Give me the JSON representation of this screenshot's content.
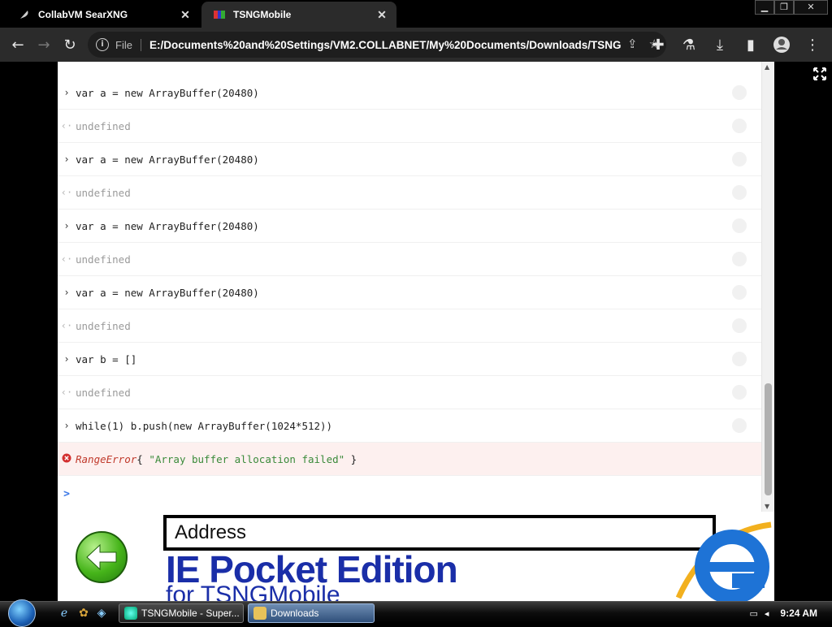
{
  "browser": {
    "tabs": [
      {
        "title": "CollabVM SearXNG",
        "active": false
      },
      {
        "title": "TSNGMobile",
        "active": true
      }
    ],
    "window_controls": [
      "minimize",
      "restore",
      "close"
    ],
    "omnibox": {
      "scheme": "File",
      "url": "E:/Documents%20and%20Settings/VM2.COLLABNET/My%20Documents/Downloads/TSNG..."
    }
  },
  "console": {
    "rows": [
      {
        "kind": "input",
        "text": "var a = new ArrayBuffer(20480)"
      },
      {
        "kind": "output",
        "text": "undefined"
      },
      {
        "kind": "input",
        "text": "var a = new ArrayBuffer(20480)"
      },
      {
        "kind": "output",
        "text": "undefined"
      },
      {
        "kind": "input",
        "text": "var a = new ArrayBuffer(20480)"
      },
      {
        "kind": "output",
        "text": "undefined"
      },
      {
        "kind": "input",
        "text": "var a = new ArrayBuffer(20480)"
      },
      {
        "kind": "output",
        "text": "undefined"
      },
      {
        "kind": "input",
        "text": "var b = []"
      },
      {
        "kind": "output",
        "text": "undefined"
      },
      {
        "kind": "input",
        "text": "while(1) b.push(new ArrayBuffer(1024*512))"
      }
    ],
    "error": {
      "name": "RangeError",
      "open": "{ ",
      "message": "\"Array buffer allocation failed\"",
      "close": " }"
    },
    "prompt_symbol": ">"
  },
  "banner": {
    "address_label": "Address",
    "title": "IE Pocket Edition",
    "subtitle": "for TSNGMobile"
  },
  "taskbar": {
    "tasks": [
      {
        "label": "TSNGMobile - Super...",
        "active": false
      },
      {
        "label": "Downloads",
        "active": true
      }
    ],
    "clock": "9:24 AM"
  },
  "colors": {
    "error_red": "#c0392b",
    "string_green": "#3a8a3a",
    "prompt_blue": "#3b78e7",
    "ie_blue": "#1a2ea8"
  }
}
